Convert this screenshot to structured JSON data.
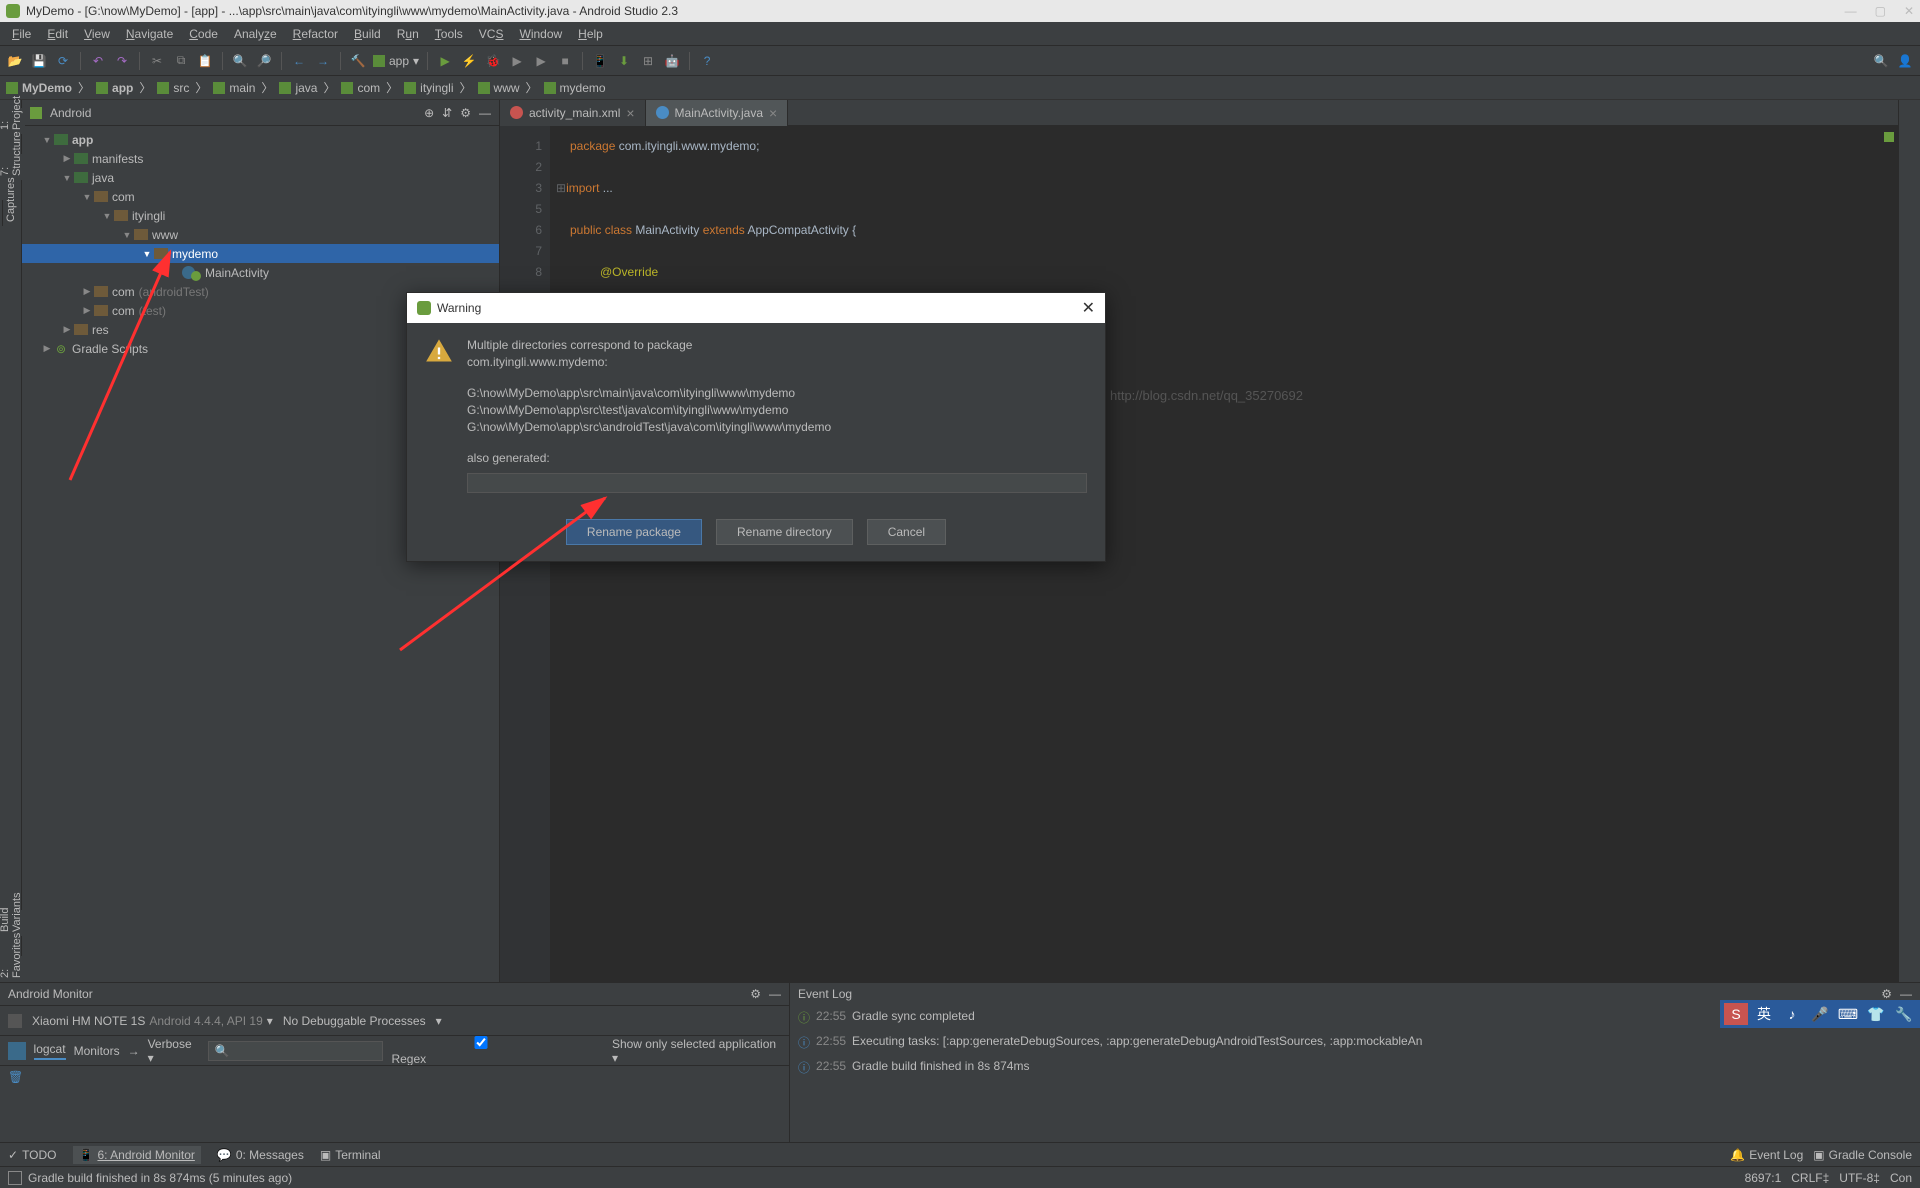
{
  "titlebar": {
    "text": "MyDemo - [G:\\now\\MyDemo] - [app] - ...\\app\\src\\main\\java\\com\\ityingli\\www\\mydemo\\MainActivity.java - Android Studio 2.3"
  },
  "menubar": [
    "File",
    "Edit",
    "View",
    "Navigate",
    "Code",
    "Analyze",
    "Refactor",
    "Build",
    "Run",
    "Tools",
    "VCS",
    "Window",
    "Help"
  ],
  "runconfig": "app",
  "breadcrumbs": [
    "MyDemo",
    "app",
    "src",
    "main",
    "java",
    "com",
    "ityingli",
    "www",
    "mydemo"
  ],
  "projectHeader": "Android",
  "tree": {
    "app": "app",
    "manifests": "manifests",
    "java": "java",
    "com": "com",
    "ityingli": "ityingli",
    "www": "www",
    "mydemo": "mydemo",
    "mainactivity": "MainActivity",
    "comAT": "com",
    "comATdim": "(androidTest)",
    "comTest": "com",
    "comTestdim": "(test)",
    "res": "res",
    "gradle": "Gradle Scripts"
  },
  "tabs": {
    "xml": "activity_main.xml",
    "java": "MainActivity.java"
  },
  "code": {
    "l1a": "package",
    "l1b": " com.ityingli.www.mydemo;",
    "l4a": "import",
    "l4b": " ...",
    "l6a": "public class ",
    "l6b": "MainActivity ",
    "l6c": "extends ",
    "l6d": "AppCompatActivity {",
    "l8a": "@Override"
  },
  "dialog": {
    "title": "Warning",
    "p1a": "Multiple directories correspond to package",
    "p1b": "com.ityingli.www.mydemo:",
    "d1": "G:\\now\\MyDemo\\app\\src\\main\\java\\com\\ityingli\\www\\mydemo",
    "d2": "G:\\now\\MyDemo\\app\\src\\test\\java\\com\\ityingli\\www\\mydemo",
    "d3": "G:\\now\\MyDemo\\app\\src\\androidTest\\java\\com\\ityingli\\www\\mydemo",
    "also": "also generated:",
    "btn1": "Rename package",
    "btn2": "Rename directory",
    "btn3": "Cancel"
  },
  "monitor": {
    "title": "Android Monitor",
    "device": "Xiaomi HM NOTE 1S",
    "api": "Android 4.4.4, API 19",
    "nodbg": "No Debuggable Processes",
    "logcat": "logcat",
    "monitors": "Monitors",
    "verbose": "Verbose",
    "regex": "Regex",
    "showonly": "Show only selected application"
  },
  "eventlog": {
    "title": "Event Log",
    "r1t": "22:55",
    "r1m": "Gradle sync completed",
    "r2t": "22:55",
    "r2m": "Executing tasks: [:app:generateDebugSources, :app:generateDebugAndroidTestSources, :app:mockableAn",
    "r3t": "22:55",
    "r3m": "Gradle build finished in 8s 874ms"
  },
  "bottombar": {
    "todo": "TODO",
    "am": "6: Android Monitor",
    "msg": "0: Messages",
    "term": "Terminal",
    "el": "Event Log",
    "gc": "Gradle Console"
  },
  "statusbar": {
    "msg": "Gradle build finished in 8s 874ms (5 minutes ago)",
    "pos": "8697:1",
    "crlf": "CRLF",
    "enc": "UTF-8",
    "ctx": "Con"
  },
  "sideTabs": {
    "project": "1: Project",
    "structure": "7: Structure",
    "captures": "Captures",
    "buildv": "Build Variants",
    "fav": "2: Favorites"
  },
  "watermark": "http://blog.csdn.net/qq_35270692"
}
